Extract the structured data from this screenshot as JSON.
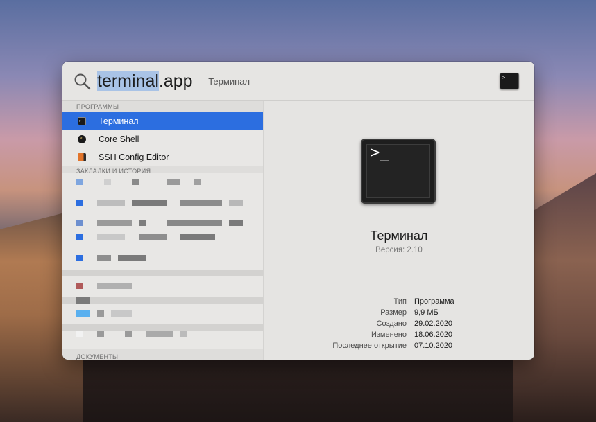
{
  "search": {
    "query_selected": "terminal",
    "query_rest": ".app",
    "query_suffix": "— Терминал"
  },
  "sections": {
    "programs": "ПРОГРАММЫ",
    "bookmarks": "ЗАКЛАДКИ И ИСТОРИЯ",
    "documents": "ДОКУМЕНТЫ"
  },
  "results": [
    {
      "label": "Терминал",
      "icon": "terminal-icon"
    },
    {
      "label": "Core Shell",
      "icon": "core-shell-icon"
    },
    {
      "label": "SSH Config Editor",
      "icon": "ssh-config-editor-icon"
    }
  ],
  "preview": {
    "app_name": "Терминал",
    "version": "Версия: 2.10",
    "meta": [
      {
        "key": "Тип",
        "value": "Программа"
      },
      {
        "key": "Размер",
        "value": "9,9 МБ"
      },
      {
        "key": "Создано",
        "value": "29.02.2020"
      },
      {
        "key": "Изменено",
        "value": "18.06.2020"
      },
      {
        "key": "Последнее открытие",
        "value": "07.10.2020"
      }
    ]
  },
  "colors": {
    "selection": "#2c6ee0",
    "query_highlight": "#a9c3e6",
    "panel_bg": "#e5e4e2"
  }
}
